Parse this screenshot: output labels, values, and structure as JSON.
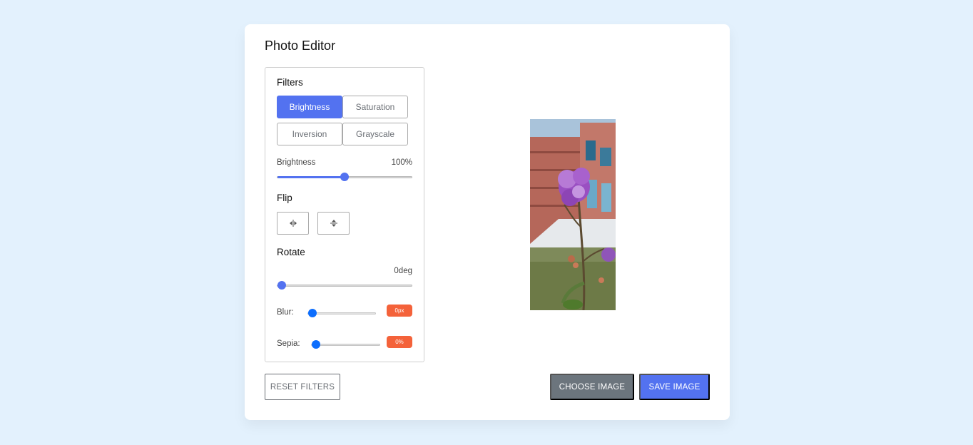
{
  "title": "Photo Editor",
  "filters": {
    "heading": "Filters",
    "buttons": [
      {
        "label": "Brightness",
        "active": true
      },
      {
        "label": "Saturation",
        "active": false
      },
      {
        "label": "Inversion",
        "active": false
      },
      {
        "label": "Grayscale",
        "active": false
      }
    ],
    "slider_name": "Brightness",
    "slider_value": "100%",
    "slider_fraction": 0.5
  },
  "flip": {
    "heading": "Flip",
    "buttons": [
      "flip-horizontal-icon",
      "flip-vertical-icon"
    ]
  },
  "rotate": {
    "heading": "Rotate",
    "value": "0deg",
    "fraction": 0
  },
  "blur": {
    "label": "Blur:",
    "value": "0px",
    "fraction": 0
  },
  "sepia": {
    "label": "Sepia:",
    "value": "0%",
    "fraction": 0
  },
  "actions": {
    "reset": "RESET FILTERS",
    "choose": "CHOOSE IMAGE",
    "save": "SAVE IMAGE"
  },
  "colors": {
    "accent": "#5372f0",
    "secondary": "#6c757d",
    "badge": "#f4623a",
    "background": "#e3f1fd"
  }
}
